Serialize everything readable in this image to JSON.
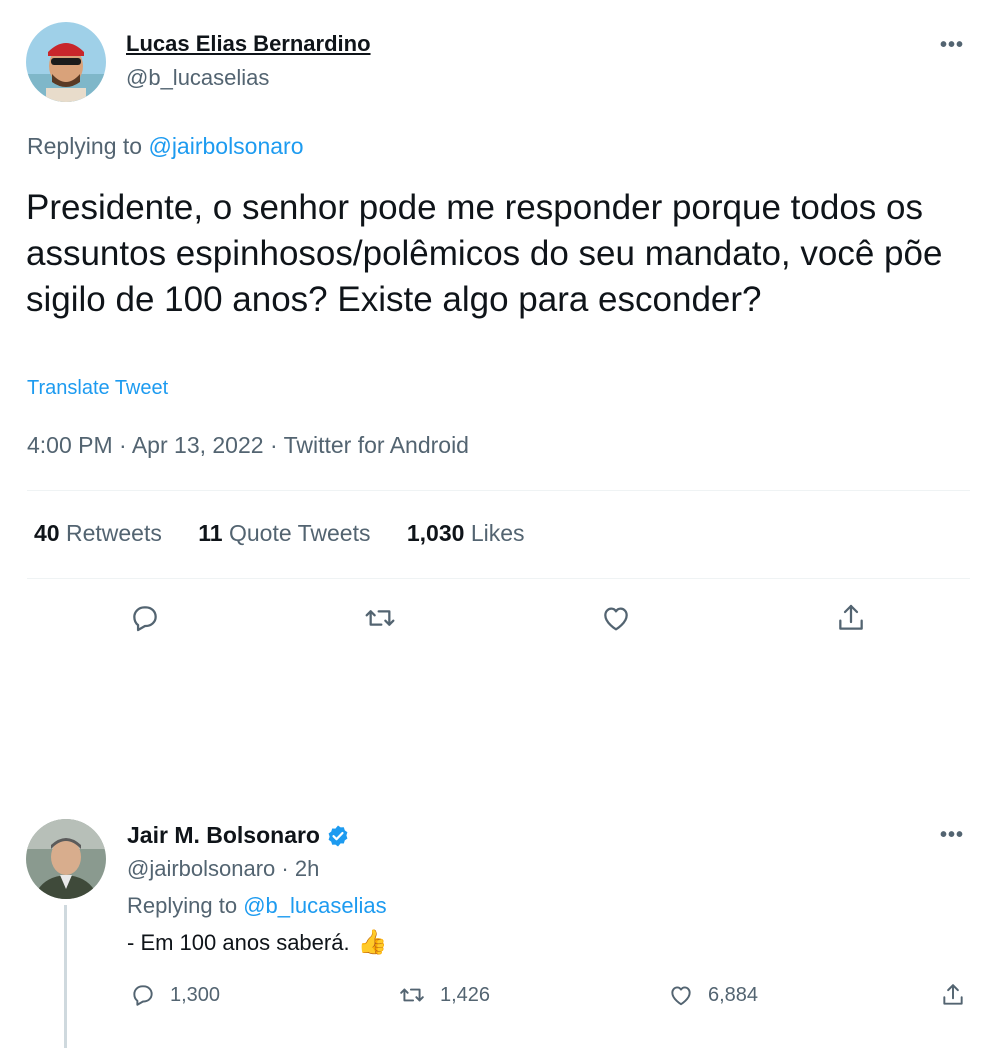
{
  "tweet": {
    "author_name": "Lucas Elias Bernardino",
    "author_handle": "@b_lucaselias",
    "replying_label": "Replying to",
    "replying_to": "@jairbolsonaro",
    "text": "Presidente, o senhor pode me responder porque todos os assuntos espinhosos/polêmicos do seu mandato, você põe sigilo de 100 anos? Existe algo para esconder?",
    "translate": "Translate Tweet",
    "time": "4:00 PM",
    "date": "Apr 13, 2022",
    "source": "Twitter for Android",
    "sep": "·",
    "stats": {
      "retweets_count": "40",
      "retweets_label": "Retweets",
      "quotes_count": "11",
      "quotes_label": "Quote Tweets",
      "likes_count": "1,030",
      "likes_label": "Likes"
    },
    "more": "•••"
  },
  "reply": {
    "author_name": "Jair M. Bolsonaro",
    "author_handle": "@jairbolsonaro",
    "sep": "·",
    "age": "2h",
    "replying_label": "Replying to",
    "replying_to": "@b_lucaselias",
    "text": "- Em 100 anos saberá.",
    "emoji": "👍",
    "replies": "1,300",
    "retweets": "1,426",
    "likes": "6,884",
    "more": "•••"
  },
  "colors": {
    "accent": "#1d9bf0",
    "muted": "#536471",
    "text": "#0f1419",
    "divider": "#eff3f4"
  },
  "icons": [
    "reply-icon",
    "retweet-icon",
    "like-icon",
    "share-icon",
    "verified-badge-icon",
    "more-icon"
  ]
}
